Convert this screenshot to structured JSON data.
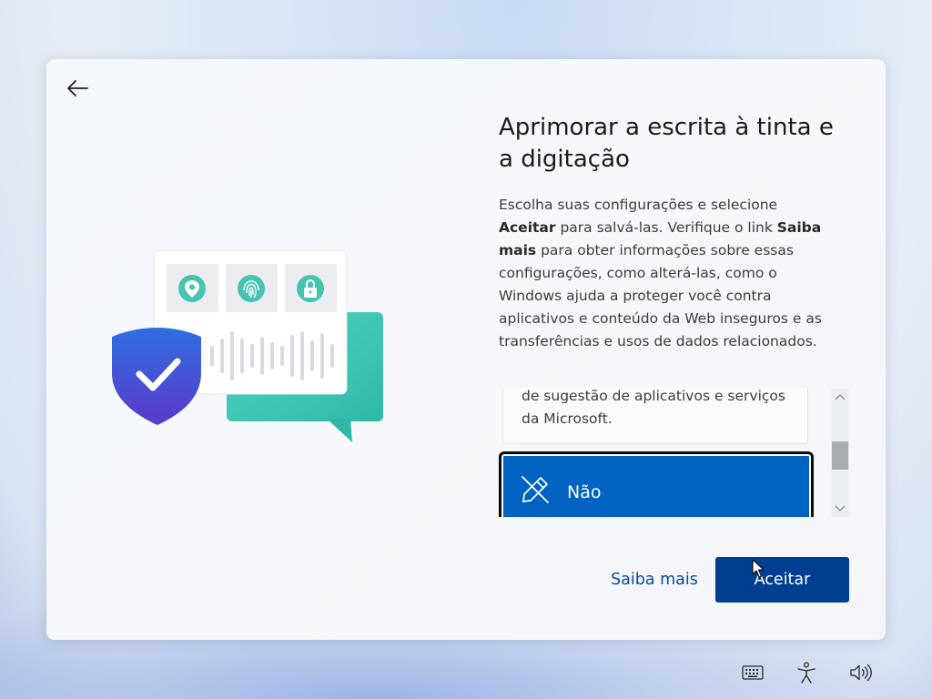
{
  "header": {
    "title": "Aprimorar a escrita à tinta e a digitação",
    "back_icon": "back-arrow-icon"
  },
  "description": {
    "part1": "Escolha suas configurações e selecione ",
    "accept_bold": "Aceitar",
    "part2": " para salvá-las. Verifique o link ",
    "learn_more_bold": "Saiba mais",
    "part3": " para obter informações sobre essas configurações, como alterá-las, como o Windows ajuda a proteger você contra aplicativos e conteúdo da Web inseguros e as transferências e usos de dados relacionados."
  },
  "options": {
    "yes_partial_desc": "de sugestão de aplicativos e serviços da Microsoft.",
    "no_label": "Não",
    "no_icon": "pen-off-icon"
  },
  "illustration": {
    "icons": [
      "location-pin-icon",
      "fingerprint-icon",
      "padlock-icon",
      "shield-check-icon",
      "voice-wave-icon"
    ]
  },
  "footer": {
    "learn_more_label": "Saiba mais",
    "accept_label": "Aceitar"
  },
  "taskbar": {
    "icons": [
      "keyboard-icon",
      "accessibility-icon",
      "volume-icon"
    ]
  },
  "colors": {
    "accent": "#0063c1",
    "accept_button": "#003e92",
    "link": "#0a4a9a",
    "teal": "#3cc6b4",
    "shield": "#3b4ed8"
  }
}
